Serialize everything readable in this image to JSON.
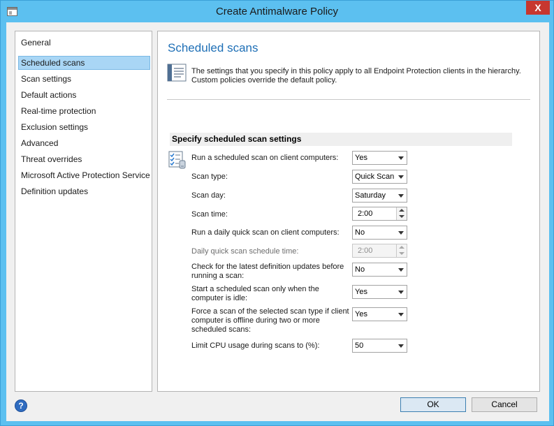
{
  "window": {
    "title": "Create Antimalware Policy",
    "close_glyph": "X"
  },
  "sidebar": {
    "items": [
      {
        "label": "General"
      },
      {
        "label": "Scheduled scans",
        "selected": true
      },
      {
        "label": "Scan settings"
      },
      {
        "label": "Default actions"
      },
      {
        "label": "Real-time protection"
      },
      {
        "label": "Exclusion settings"
      },
      {
        "label": "Advanced"
      },
      {
        "label": "Threat overrides"
      },
      {
        "label": "Microsoft Active Protection Service"
      },
      {
        "label": "Definition updates"
      }
    ]
  },
  "main": {
    "title": "Scheduled scans",
    "info_text": "The settings that you specify in this policy apply to all Endpoint Protection clients in the hierarchy. Custom policies override the default policy.",
    "section_header": "Specify scheduled scan settings",
    "settings": [
      {
        "label": "Run a scheduled scan on client computers:",
        "value": "Yes",
        "control": "select"
      },
      {
        "label": "Scan type:",
        "value": "Quick Scan",
        "control": "select"
      },
      {
        "label": "Scan day:",
        "value": "Saturday",
        "control": "select"
      },
      {
        "label": "Scan time:",
        "value": "2:00",
        "control": "spinner"
      },
      {
        "label": "Run a daily quick scan on client computers:",
        "value": "No",
        "control": "select"
      },
      {
        "label": "Daily quick scan schedule time:",
        "value": "2:00",
        "control": "spinner",
        "disabled": true
      },
      {
        "label": "Check for the latest definition updates before running a scan:",
        "value": "No",
        "control": "select"
      },
      {
        "label": "Start a scheduled scan only when the computer is idle:",
        "value": "Yes",
        "control": "select"
      },
      {
        "label": "Force a scan of the selected scan type if client computer is offline during two or more scheduled scans:",
        "value": "Yes",
        "control": "select"
      },
      {
        "label": "Limit CPU usage during scans to (%):",
        "value": "50",
        "control": "select"
      }
    ]
  },
  "footer": {
    "help_glyph": "?",
    "ok_label": "OK",
    "cancel_label": "Cancel"
  },
  "icons": {
    "window": "window-icon",
    "close": "close-icon",
    "info": "info-document-icon",
    "scan": "checklist-icon",
    "help": "help-icon",
    "dropdown": "chevron-down-icon",
    "spin": "spin-arrows-icon"
  },
  "colors": {
    "titlebar": "#5cc0f0",
    "close": "#c7372f",
    "page_title": "#1e6fb6",
    "selection": "#a9d6f5"
  }
}
